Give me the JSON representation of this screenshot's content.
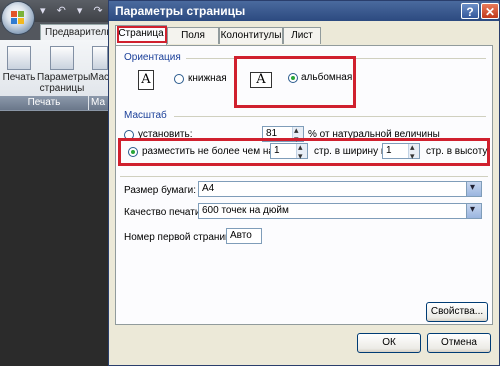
{
  "excel": {
    "qat_glyphs": "▾ ↶ ▾ ↷ ▾",
    "ribbon_tab": "Предварительный",
    "buttons": [
      {
        "label": "Печать"
      },
      {
        "label": "Параметры страницы"
      },
      {
        "label": "Масш"
      }
    ],
    "group_label": "Печать",
    "group_label2": "Ма"
  },
  "dialog": {
    "title": "Параметры страницы",
    "help_glyph": "?",
    "close_glyph": "✕",
    "tabs": [
      "Страница",
      "Поля",
      "Колонтитулы",
      "Лист"
    ],
    "orientation": {
      "label": "Ориентация",
      "portrait": "книжная",
      "landscape": "альбомная",
      "icon_letter": "A"
    },
    "scale": {
      "label": "Масштаб",
      "set_label": "установить:",
      "set_value": "81",
      "set_suffix": "% от натуральной величины",
      "fit_label": "разместить не более чем на:",
      "width_value": "1",
      "width_suffix": "стр. в ширину и",
      "height_value": "1",
      "height_suffix": "стр. в высоту"
    },
    "paper_size": {
      "label": "Размер бумаги:",
      "value": "A4"
    },
    "print_quality": {
      "label": "Качество печати:",
      "value": "600 точек на дюйм"
    },
    "first_page": {
      "label": "Номер первой страницы:",
      "value": "Авто"
    },
    "properties_button": "Свойства...",
    "ok_button": "ОК",
    "cancel_button": "Отмена"
  }
}
